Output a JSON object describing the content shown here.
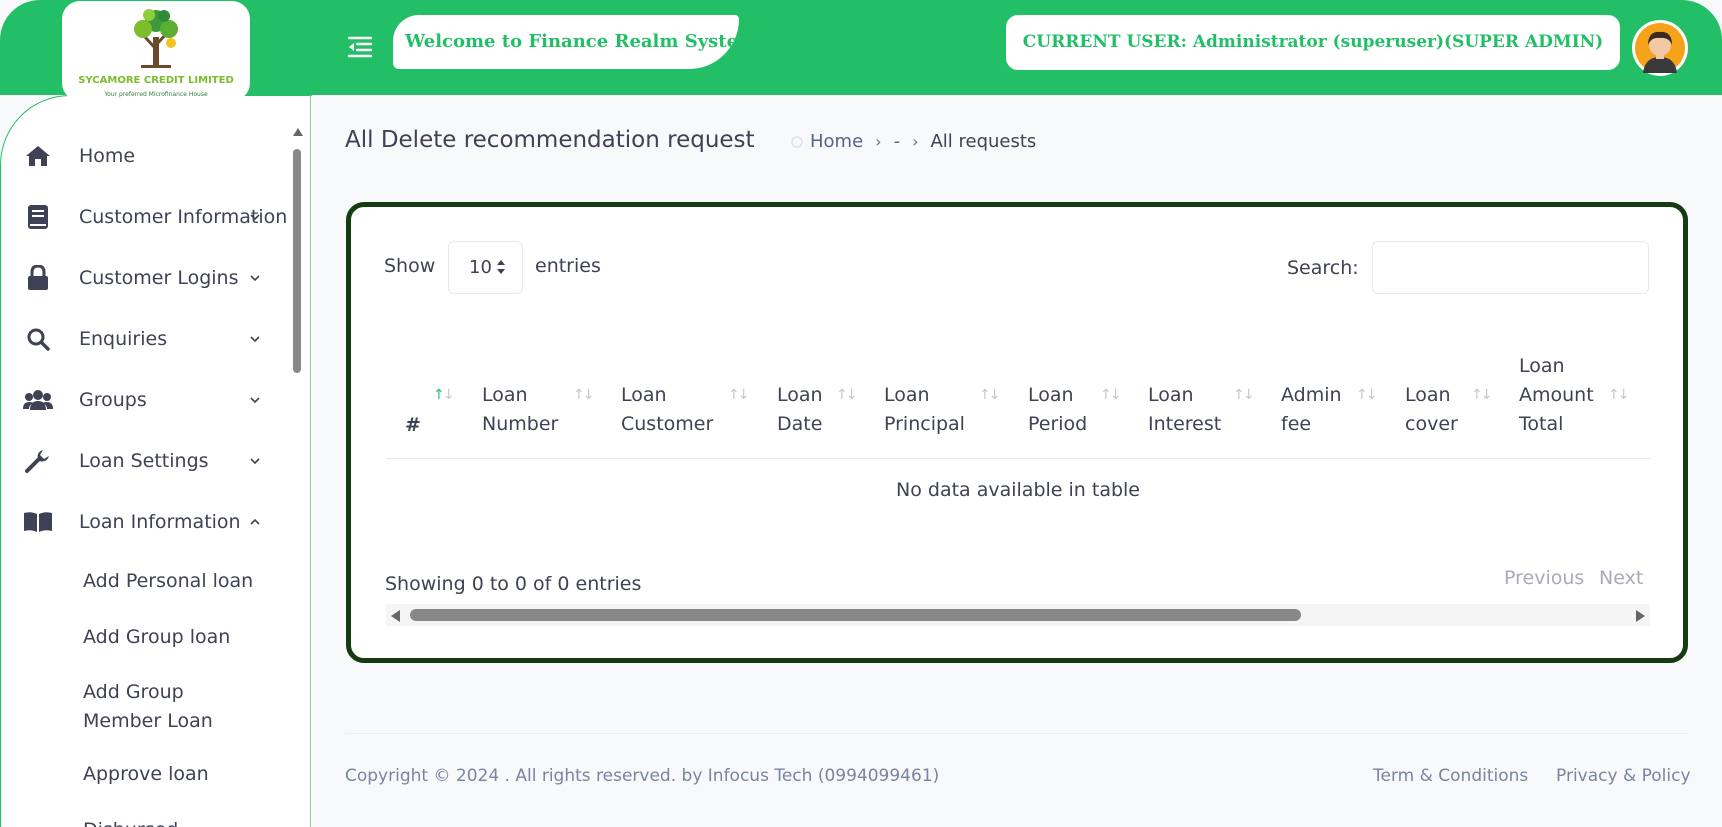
{
  "brand": {
    "name": "SYCAMORE CREDIT LIMITED",
    "tagline": "Your preferred Microfinance House"
  },
  "header": {
    "welcome": "Welcome to Finance Realm System",
    "current_user": "CURRENT USER: Administrator (superuser)(SUPER ADMIN)",
    "accent_color": "#22bf67"
  },
  "sidebar": {
    "items": [
      {
        "label": "Home",
        "icon": "home-icon"
      },
      {
        "label": "Customer Information",
        "icon": "book-icon"
      },
      {
        "label": "Customer Logins",
        "icon": "lock-icon"
      },
      {
        "label": "Enquiries",
        "icon": "search-icon"
      },
      {
        "label": "Groups",
        "icon": "users-icon"
      },
      {
        "label": "Loan Settings",
        "icon": "wrench-icon"
      },
      {
        "label": "Loan Information",
        "icon": "open-book-icon"
      }
    ],
    "sub_items": [
      "Add Personal loan",
      "Add Group loan",
      "Add Group",
      "Member Loan",
      "Approve loan",
      "Disbursed"
    ]
  },
  "page": {
    "title": "All Delete recommendation request",
    "breadcrumb": {
      "home": "Home",
      "middle": "-",
      "current": "All requests"
    }
  },
  "table": {
    "show_label": "Show",
    "page_size": "10",
    "entries_label": "entries",
    "search_label": "Search:",
    "search_value": "",
    "columns": [
      {
        "l1": "#",
        "l2": ""
      },
      {
        "l1": "Loan",
        "l2": "Number"
      },
      {
        "l1": "Loan",
        "l2": "Customer"
      },
      {
        "l1": "Loan",
        "l2": "Date"
      },
      {
        "l1": "Loan",
        "l2": "Principal"
      },
      {
        "l1": "Loan",
        "l2": "Period"
      },
      {
        "l1": "Loan",
        "l2": "Interest"
      },
      {
        "l1": "Admin",
        "l2": "fee"
      },
      {
        "l1": "Loan",
        "l2": "cover"
      },
      {
        "l1": "Loan",
        "l2": "Amount",
        "l3": "Total"
      }
    ],
    "empty_message": "No data available in table",
    "info": "Showing 0 to 0 of 0 entries",
    "prev": "Previous",
    "next": "Next"
  },
  "footer": {
    "copyright": "Copyright © 2024 . All rights reserved. by Infocus Tech (0994099461)",
    "terms": "Term & Conditions",
    "privacy": "Privacy & Policy"
  }
}
